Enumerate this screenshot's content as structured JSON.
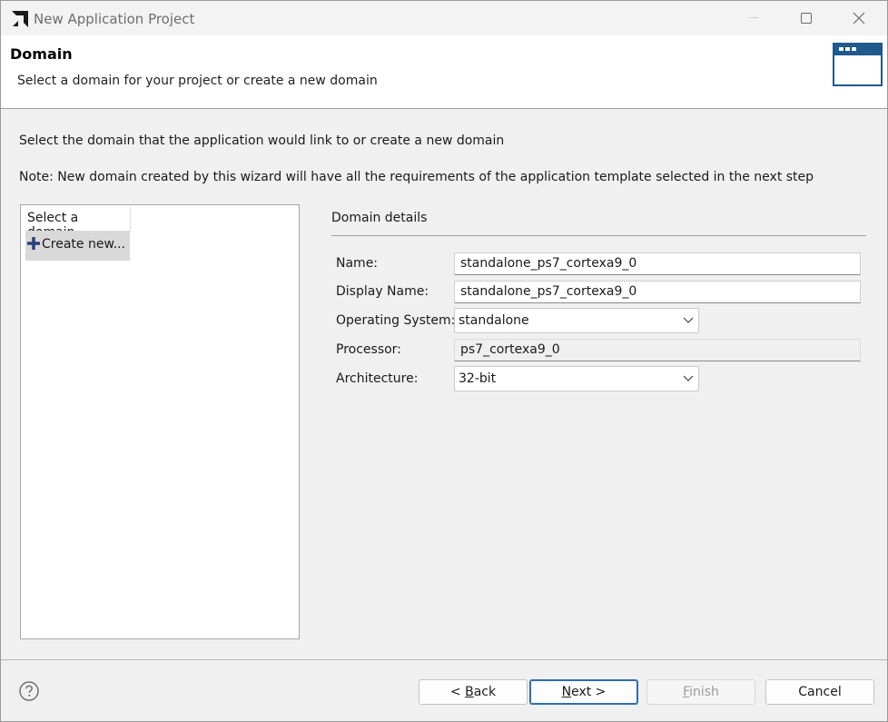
{
  "window": {
    "title": "New Application Project"
  },
  "header": {
    "title": "Domain",
    "subtitle": "Select a domain for your project or create a new domain",
    "icon": "window-icon"
  },
  "intro_text": "Select the domain that the application would link to or create a new domain",
  "note_text": "Note: New domain created by this wizard will have all the requirements of the application template selected in the next step",
  "domain_list": {
    "header": "Select a domain",
    "items": [
      {
        "label": "Create new...",
        "icon": "plus-icon",
        "selected": true
      }
    ]
  },
  "details": {
    "title": "Domain details",
    "name": {
      "label": "Name:",
      "value": "standalone_ps7_cortexa9_0"
    },
    "display_name": {
      "label": "Display Name:",
      "value": "standalone_ps7_cortexa9_0"
    },
    "os": {
      "label": "Operating System:",
      "value": "standalone"
    },
    "processor": {
      "label": "Processor:",
      "value": "ps7_cortexa9_0"
    },
    "architecture": {
      "label": "Architecture:",
      "value": "32-bit"
    }
  },
  "footer": {
    "back": {
      "prefix": "< ",
      "mnemonic": "B",
      "rest": "ack"
    },
    "next": {
      "mnemonic": "N",
      "rest": "ext >"
    },
    "finish": {
      "mnemonic": "F",
      "rest": "inish"
    },
    "cancel": "Cancel"
  },
  "colors": {
    "accent": "#2e6cb5",
    "header_icon": "#1f5a8c"
  }
}
